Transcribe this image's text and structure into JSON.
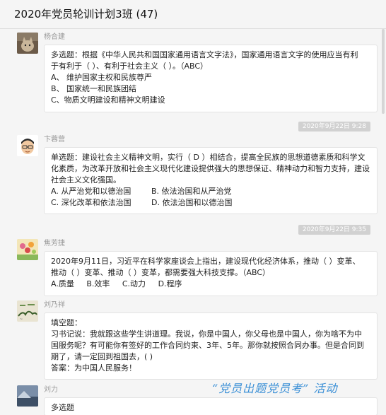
{
  "window": {
    "title": "2020年党员轮训计划3班 (47)"
  },
  "messages": [
    {
      "sender": "杨合建",
      "avatar": "avatar-cat",
      "lines": [
        "多选题：根据《中华人民共和国国家通用语言文字法》，国家通用语言文字的使用应当有利",
        "于有利于（  ）、有利于社会主义（  ）。（ABC）",
        "A、  维护国家主权和民族尊严",
        "B、  国家统一和民族团结",
        "C、物质文明建设和精神文明建设"
      ]
    },
    {
      "timestamp": "2020年9月22日 9:28"
    },
    {
      "sender": "卞蓉营",
      "avatar": "avatar-cartoon-man",
      "intro": "单选题：建设社会主义精神文明，实行（ D ）相结合，提高全民族的思想道德素质和科学文化素质，为改革开放和社会主义现代化建设提供强大的思想保证、精神动力和智力支持，建设社会主义文化强国。",
      "options": [
        [
          "A. 从严治党和以德治国",
          "B. 依法治国和从严治党"
        ],
        [
          "C. 深化改革和依法治国",
          "D. 依法治国和以德治国"
        ]
      ]
    },
    {
      "timestamp": "2020年9月22日 9:35"
    },
    {
      "sender": "焦芳捷",
      "avatar": "avatar-flowers",
      "lines": [
        "2020年9月11日，习近平在科学家座谈会上指出，建设现代化经济体系，推动（  ）变革、",
        "推动（  ）变革、推动（  ）变革，都需要强大科技支撑。（ABC）"
      ],
      "inline_options": [
        "A.质量",
        "B.效率",
        "C.动力",
        "D.程序"
      ]
    },
    {
      "sender": "刘乃祥",
      "avatar": "avatar-painting",
      "lines": [
        "填空题：",
        "习书记说：我就跟这些学生讲道理。我说，你是中国人，你父母也是中国人，你为啥不为中",
        "国服务呢？有可能你有签好的工作合同约束、3年、5年。那你就按照合同办事。但是合同到",
        "期了，请一定回到祖国去，(  )",
        "答案：为中国人民服务！"
      ]
    },
    {
      "sender": "刘力",
      "avatar": "avatar-landscape",
      "lines": [
        "多选题"
      ]
    }
  ],
  "watermark": "“党员出题党员考” 活动",
  "colors": {
    "background": "#f5f5f5",
    "bubble": "#ffffff",
    "timestamp_bg": "#d1d1d1",
    "watermark": "#3a8fd6"
  }
}
